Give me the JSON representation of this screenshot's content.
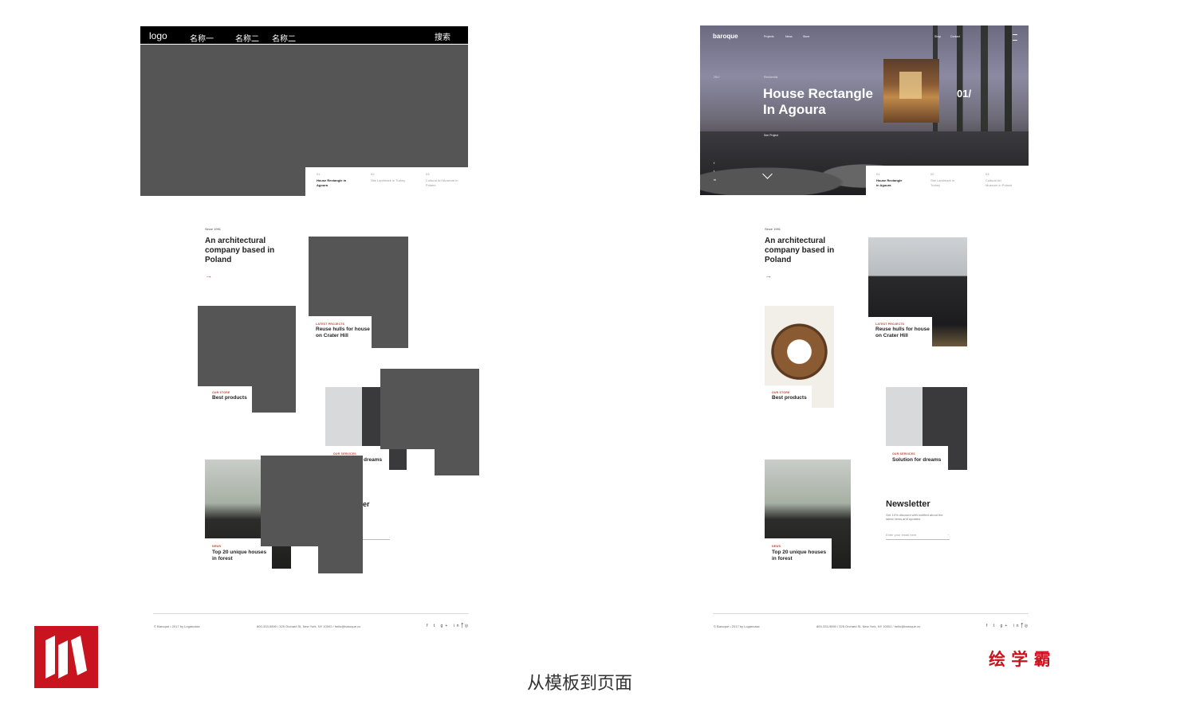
{
  "template": {
    "nav": {
      "logo": "logo",
      "items": [
        "名称一",
        "名称二",
        "名称二"
      ],
      "search": "搜索"
    },
    "hero_strip": [
      {
        "num": "01",
        "title": "House Rectangle in Agoura"
      },
      {
        "num": "02",
        "title": "Site Landmark in Turkey"
      },
      {
        "num": "03",
        "title": "Cultural Art Museum in Poland"
      }
    ]
  },
  "page": {
    "nav": {
      "logo": "baroque",
      "items": [
        "Projects",
        "News",
        "Store"
      ],
      "right_items": [
        "Shop",
        "Contact"
      ]
    },
    "hero": {
      "year": "2017",
      "category": "Residential",
      "title_line1": "House Rectangle",
      "title_line2": "In Agoura",
      "counter": "01/",
      "cta": "See Project",
      "social": [
        "f",
        "t",
        "in"
      ]
    },
    "hero_strip": [
      {
        "num": "01",
        "title_line1": "House Rectangle",
        "title_line2": "in Agoura"
      },
      {
        "num": "02",
        "title_line1": "Site Landmark in",
        "title_line2": "Turkey"
      },
      {
        "num": "03",
        "title_line1": "Cultural Art",
        "title_line2": "Museum in Poland"
      }
    ]
  },
  "intro": {
    "since": "Since 1991",
    "title_line1": "An architectural",
    "title_line2": "company based in",
    "title_line3": "Poland",
    "arrow": "→"
  },
  "cards": [
    {
      "category": "LATEST PROJECTS",
      "title_line1": "Reuse hulls for house",
      "title_line2": "on Crater Hill"
    },
    {
      "category": "OUR STORE",
      "title_line1": "Best products",
      "title_line2": ""
    },
    {
      "category": "OUR SERVICES",
      "title_line1": "Solution for dreams",
      "title_line2": ""
    },
    {
      "category": "NEWS",
      "title_line1": "Top 20 unique houses",
      "title_line2": "in forest"
    }
  ],
  "template_fragments": {
    "dreams": "dreams",
    "newsletter": "er"
  },
  "newsletter": {
    "title": "Newsletter",
    "text": "Get 10% discount with notified about the latest news and updates.",
    "placeholder": "Enter your email here",
    "arrow": "→"
  },
  "footer": {
    "copyright": "© Baroque • 2017 by Logancase",
    "contact": "800-333-9890  /  325 Orchard St, New York, NY 10002  /  hello@baroque.co",
    "social": "f t g+ in ◎",
    "up": "↑"
  },
  "caption": "从模板到页面",
  "brand_text": "绘 学 霸",
  "colors": {
    "accent": "#c2452d",
    "placeholder": "#555555",
    "brand": "#c8141e"
  }
}
